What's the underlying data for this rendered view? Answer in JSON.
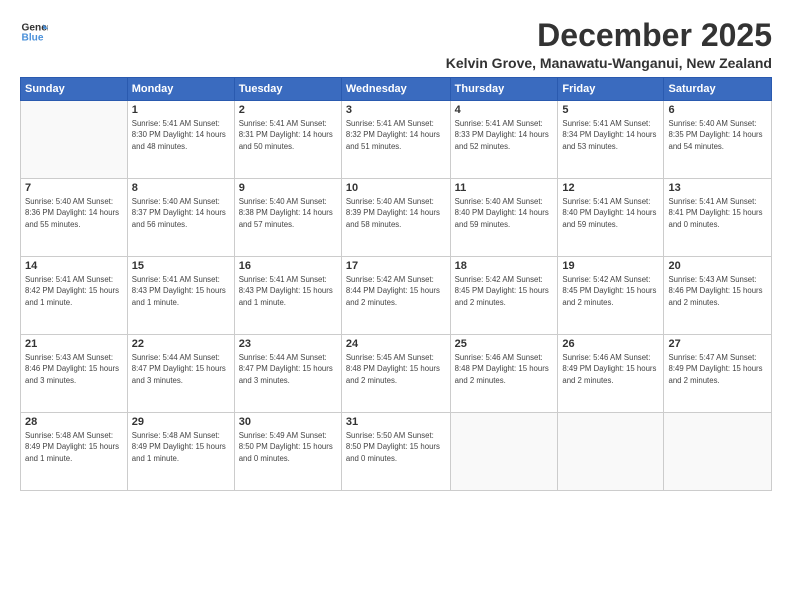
{
  "logo": {
    "line1": "General",
    "line2": "Blue"
  },
  "title": "December 2025",
  "subtitle": "Kelvin Grove, Manawatu-Wanganui, New Zealand",
  "days_of_week": [
    "Sunday",
    "Monday",
    "Tuesday",
    "Wednesday",
    "Thursday",
    "Friday",
    "Saturday"
  ],
  "weeks": [
    [
      {
        "day": "",
        "info": ""
      },
      {
        "day": "1",
        "info": "Sunrise: 5:41 AM\nSunset: 8:30 PM\nDaylight: 14 hours\nand 48 minutes."
      },
      {
        "day": "2",
        "info": "Sunrise: 5:41 AM\nSunset: 8:31 PM\nDaylight: 14 hours\nand 50 minutes."
      },
      {
        "day": "3",
        "info": "Sunrise: 5:41 AM\nSunset: 8:32 PM\nDaylight: 14 hours\nand 51 minutes."
      },
      {
        "day": "4",
        "info": "Sunrise: 5:41 AM\nSunset: 8:33 PM\nDaylight: 14 hours\nand 52 minutes."
      },
      {
        "day": "5",
        "info": "Sunrise: 5:41 AM\nSunset: 8:34 PM\nDaylight: 14 hours\nand 53 minutes."
      },
      {
        "day": "6",
        "info": "Sunrise: 5:40 AM\nSunset: 8:35 PM\nDaylight: 14 hours\nand 54 minutes."
      }
    ],
    [
      {
        "day": "7",
        "info": "Sunrise: 5:40 AM\nSunset: 8:36 PM\nDaylight: 14 hours\nand 55 minutes."
      },
      {
        "day": "8",
        "info": "Sunrise: 5:40 AM\nSunset: 8:37 PM\nDaylight: 14 hours\nand 56 minutes."
      },
      {
        "day": "9",
        "info": "Sunrise: 5:40 AM\nSunset: 8:38 PM\nDaylight: 14 hours\nand 57 minutes."
      },
      {
        "day": "10",
        "info": "Sunrise: 5:40 AM\nSunset: 8:39 PM\nDaylight: 14 hours\nand 58 minutes."
      },
      {
        "day": "11",
        "info": "Sunrise: 5:40 AM\nSunset: 8:40 PM\nDaylight: 14 hours\nand 59 minutes."
      },
      {
        "day": "12",
        "info": "Sunrise: 5:41 AM\nSunset: 8:40 PM\nDaylight: 14 hours\nand 59 minutes."
      },
      {
        "day": "13",
        "info": "Sunrise: 5:41 AM\nSunset: 8:41 PM\nDaylight: 15 hours\nand 0 minutes."
      }
    ],
    [
      {
        "day": "14",
        "info": "Sunrise: 5:41 AM\nSunset: 8:42 PM\nDaylight: 15 hours\nand 1 minute."
      },
      {
        "day": "15",
        "info": "Sunrise: 5:41 AM\nSunset: 8:43 PM\nDaylight: 15 hours\nand 1 minute."
      },
      {
        "day": "16",
        "info": "Sunrise: 5:41 AM\nSunset: 8:43 PM\nDaylight: 15 hours\nand 1 minute."
      },
      {
        "day": "17",
        "info": "Sunrise: 5:42 AM\nSunset: 8:44 PM\nDaylight: 15 hours\nand 2 minutes."
      },
      {
        "day": "18",
        "info": "Sunrise: 5:42 AM\nSunset: 8:45 PM\nDaylight: 15 hours\nand 2 minutes."
      },
      {
        "day": "19",
        "info": "Sunrise: 5:42 AM\nSunset: 8:45 PM\nDaylight: 15 hours\nand 2 minutes."
      },
      {
        "day": "20",
        "info": "Sunrise: 5:43 AM\nSunset: 8:46 PM\nDaylight: 15 hours\nand 2 minutes."
      }
    ],
    [
      {
        "day": "21",
        "info": "Sunrise: 5:43 AM\nSunset: 8:46 PM\nDaylight: 15 hours\nand 3 minutes."
      },
      {
        "day": "22",
        "info": "Sunrise: 5:44 AM\nSunset: 8:47 PM\nDaylight: 15 hours\nand 3 minutes."
      },
      {
        "day": "23",
        "info": "Sunrise: 5:44 AM\nSunset: 8:47 PM\nDaylight: 15 hours\nand 3 minutes."
      },
      {
        "day": "24",
        "info": "Sunrise: 5:45 AM\nSunset: 8:48 PM\nDaylight: 15 hours\nand 2 minutes."
      },
      {
        "day": "25",
        "info": "Sunrise: 5:46 AM\nSunset: 8:48 PM\nDaylight: 15 hours\nand 2 minutes."
      },
      {
        "day": "26",
        "info": "Sunrise: 5:46 AM\nSunset: 8:49 PM\nDaylight: 15 hours\nand 2 minutes."
      },
      {
        "day": "27",
        "info": "Sunrise: 5:47 AM\nSunset: 8:49 PM\nDaylight: 15 hours\nand 2 minutes."
      }
    ],
    [
      {
        "day": "28",
        "info": "Sunrise: 5:48 AM\nSunset: 8:49 PM\nDaylight: 15 hours\nand 1 minute."
      },
      {
        "day": "29",
        "info": "Sunrise: 5:48 AM\nSunset: 8:49 PM\nDaylight: 15 hours\nand 1 minute."
      },
      {
        "day": "30",
        "info": "Sunrise: 5:49 AM\nSunset: 8:50 PM\nDaylight: 15 hours\nand 0 minutes."
      },
      {
        "day": "31",
        "info": "Sunrise: 5:50 AM\nSunset: 8:50 PM\nDaylight: 15 hours\nand 0 minutes."
      },
      {
        "day": "",
        "info": ""
      },
      {
        "day": "",
        "info": ""
      },
      {
        "day": "",
        "info": ""
      }
    ]
  ]
}
